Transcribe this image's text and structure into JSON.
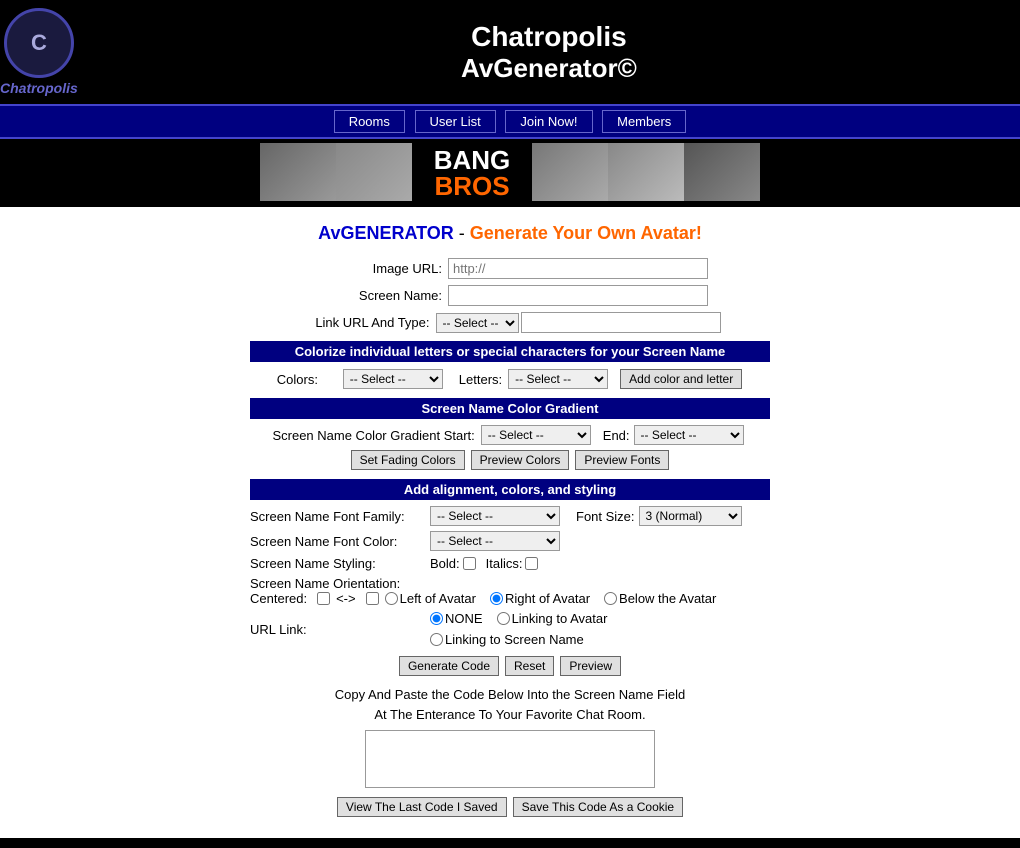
{
  "header": {
    "site_name": "Chatropolis",
    "generator_name": "AvGenerator",
    "copyright_symbol": "©",
    "logo_text": "Chatropolis"
  },
  "nav": {
    "items": [
      {
        "label": "Rooms",
        "href": "#"
      },
      {
        "label": "User List",
        "href": "#"
      },
      {
        "label": "Join Now!",
        "href": "#"
      },
      {
        "label": "Members",
        "href": "#"
      }
    ]
  },
  "page": {
    "title_prefix": "AvGENERATOR",
    "title_middle": " - ",
    "title_suffix": "Generate Your Own Avatar!",
    "image_url_label": "Image URL:",
    "image_url_placeholder": "http://",
    "screen_name_label": "Screen Name:",
    "link_url_label": "Link URL And Type:",
    "colorize_bar": "Colorize individual letters or special characters for your Screen Name",
    "colors_label": "Colors:",
    "letters_label": "Letters:",
    "add_color_button": "Add color and letter",
    "gradient_bar": "Screen Name Color Gradient",
    "gradient_start_label": "Screen Name Color Gradient Start:",
    "gradient_end_label": "End:",
    "set_fading_button": "Set Fading Colors",
    "preview_colors_button": "Preview Colors",
    "preview_fonts_button": "Preview Fonts",
    "align_bar": "Add alignment, colors, and styling",
    "font_family_label": "Screen Name Font Family:",
    "font_size_label": "Font Size:",
    "font_size_value": "3 (Normal)",
    "font_color_label": "Screen Name Font Color:",
    "styling_label": "Screen Name Styling:",
    "bold_label": "Bold:",
    "italics_label": "Italics:",
    "orientation_label": "Screen Name Orientation:",
    "centered_label": "Centered:",
    "arrows_label": "<->",
    "left_avatar_label": "Left of Avatar",
    "right_avatar_label": "Right of Avatar",
    "below_avatar_label": "Below the Avatar",
    "url_link_label": "URL Link:",
    "none_label": "NONE",
    "link_avatar_label": "Linking to Avatar",
    "link_screen_label": "Linking to Screen Name",
    "generate_button": "Generate Code",
    "reset_button": "Reset",
    "preview_button": "Preview",
    "copy_text_line1": "Copy And Paste the Code Below Into the Screen Name Field",
    "copy_text_line2": "At The Enterance To Your Favorite Chat Room.",
    "view_last_button": "View The Last Code I Saved",
    "save_cookie_button": "Save This Code As a Cookie",
    "select_default": "-- Select --",
    "select_default_short": "-- Select --"
  }
}
